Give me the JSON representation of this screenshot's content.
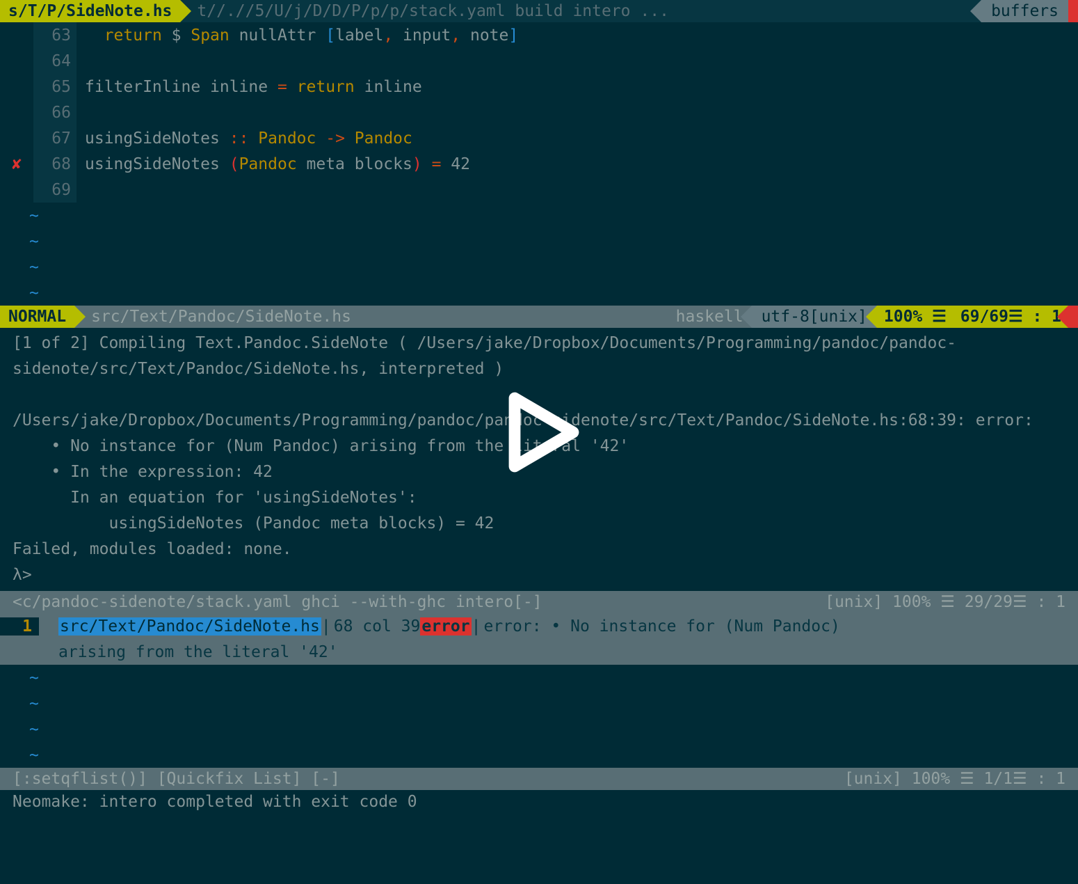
{
  "tabline": {
    "active": "s/T/P/SideNote.hs",
    "inactive": "t//.//5/U/j/D/D/P/p/p/stack.yaml build intero ...",
    "buffers": "buffers"
  },
  "editor": {
    "lines": [
      {
        "n": "63",
        "sign": "",
        "tokens": [
          [
            "  ",
            "text"
          ],
          [
            "return",
            "kw"
          ],
          [
            " $ ",
            "text"
          ],
          [
            "Span",
            "ty"
          ],
          [
            " nullAttr ",
            "text"
          ],
          [
            "[",
            "bracket"
          ],
          [
            "label",
            "text"
          ],
          [
            ", ",
            "op"
          ],
          [
            "input",
            "text"
          ],
          [
            ", ",
            "op"
          ],
          [
            "note",
            "text"
          ],
          [
            "]",
            "bracket"
          ]
        ]
      },
      {
        "n": "64",
        "sign": "",
        "tokens": []
      },
      {
        "n": "65",
        "sign": "",
        "tokens": [
          [
            "filterInline inline ",
            "text"
          ],
          [
            "=",
            "op"
          ],
          [
            " ",
            "text"
          ],
          [
            "return",
            "kw"
          ],
          [
            " inline",
            "text"
          ]
        ]
      },
      {
        "n": "66",
        "sign": "",
        "tokens": []
      },
      {
        "n": "67",
        "sign": "",
        "tokens": [
          [
            "usingSideNotes ",
            "text"
          ],
          [
            "::",
            "op"
          ],
          [
            " ",
            "text"
          ],
          [
            "Pandoc",
            "ty"
          ],
          [
            " ",
            "text"
          ],
          [
            "->",
            "op"
          ],
          [
            " ",
            "text"
          ],
          [
            "Pandoc",
            "ty"
          ]
        ]
      },
      {
        "n": "68",
        "sign": "✘",
        "tokens": [
          [
            "usingSideNotes ",
            "text"
          ],
          [
            "(",
            "paren"
          ],
          [
            "Pandoc",
            "ty"
          ],
          [
            " meta blocks",
            "text"
          ],
          [
            ")",
            "paren"
          ],
          [
            " ",
            "text"
          ],
          [
            "=",
            "op"
          ],
          [
            " 42",
            "text"
          ]
        ]
      },
      {
        "n": "69",
        "sign": "",
        "tokens": []
      }
    ],
    "tildes": 4
  },
  "statusline1": {
    "mode": "NORMAL",
    "path": "src/Text/Pandoc/SideNote.hs",
    "filetype": "haskell",
    "encoding": "utf-8[unix]",
    "percent": "100% ☰",
    "position": "69/69☰ :   1"
  },
  "terminal": {
    "text": "[1 of 2] Compiling Text.Pandoc.SideNote ( /Users/jake/Dropbox/Documents/Programming/pandoc/pandoc-sidenote/src/Text/Pandoc/SideNote.hs, interpreted )\n\n/Users/jake/Dropbox/Documents/Programming/pandoc/pandoc-sidenote/src/Text/Pandoc/SideNote.hs:68:39: error:\n    • No instance for (Num Pandoc) arising from the literal '42'\n    • In the expression: 42\n      In an equation for 'usingSideNotes':\n          usingSideNotes (Pandoc meta blocks) = 42\nFailed, modules loaded: none.\nλ>"
  },
  "statusline2": {
    "left": "<c/pandoc-sidenote/stack.yaml ghci --with-ghc intero[-]",
    "right": "[unix]   100% ☰  29/29☰ :  1"
  },
  "quickfix": {
    "num": "1",
    "file": "src/Text/Pandoc/SideNote.hs",
    "loc": "68 col 39 ",
    "tag": "error",
    "msg": "  error: • No instance for (Num Pandoc)",
    "wrap": "arising from the literal '42'"
  },
  "qf_tildes": 4,
  "statusline3": {
    "left": "[:setqflist()] [Quickfix List] [-]",
    "right": "[unix]   100% ☰   1/1☰ :  1"
  },
  "bottom": "Neomake: intero completed with exit code 0"
}
